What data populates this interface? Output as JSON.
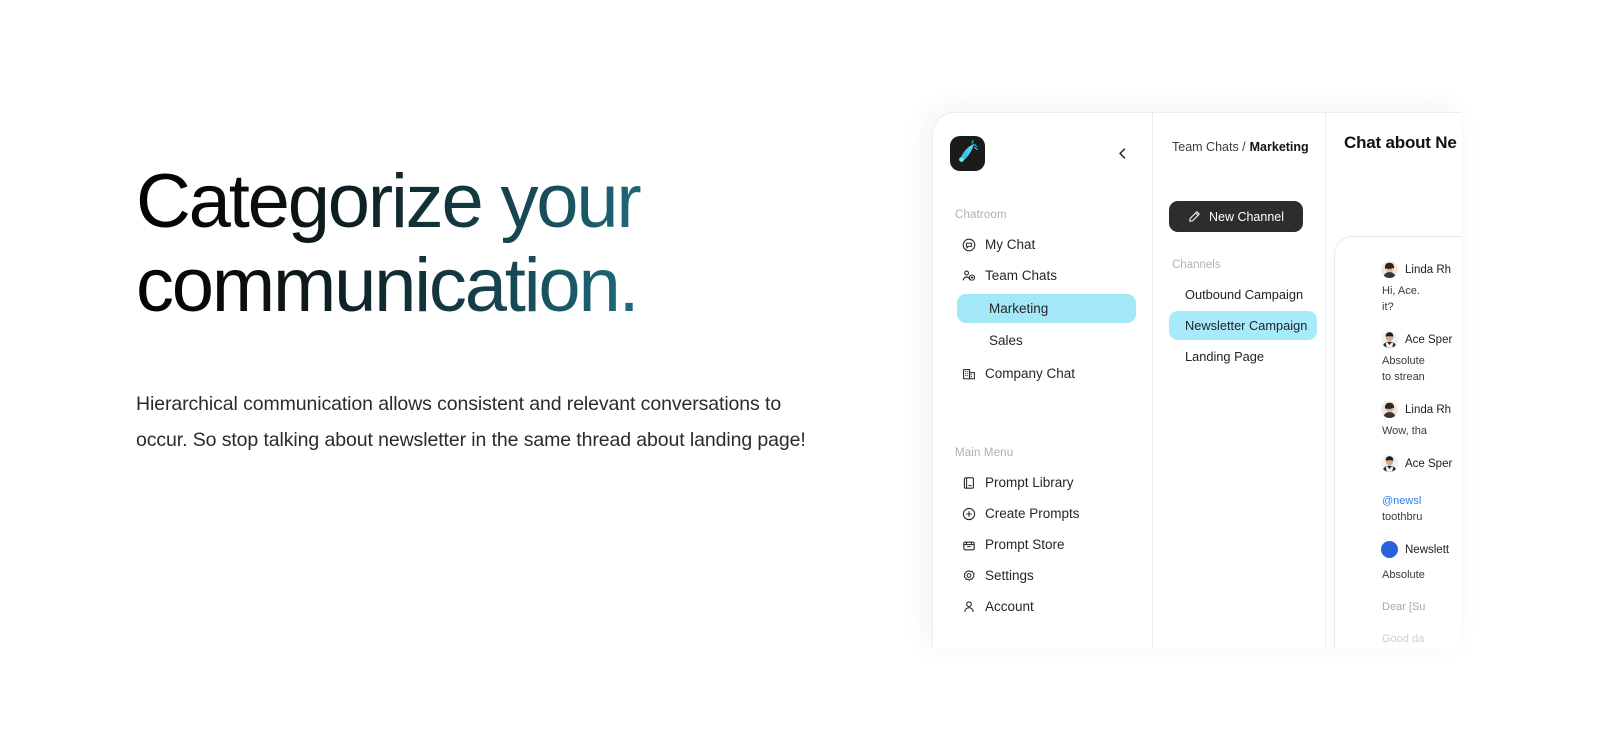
{
  "hero": {
    "headline": "Categorize your\ncommunication.",
    "body": "Hierarchical communication allows consistent and relevant conversations to\noccur. So stop talking about newsletter in the same thread about landing page!",
    "gradient_start": "#000000",
    "gradient_end": "#58c4d8"
  },
  "app": {
    "accent_highlight": "#a2e8f9",
    "dark_button": "#2d2d2d",
    "sidebar": {
      "logo_icon": "comet-feather-logo-icon",
      "collapse_icon": "chevron-left-icon",
      "groups": [
        {
          "label": "Chatroom",
          "items": [
            {
              "label": "My Chat",
              "icon": "chat-bubble-icon",
              "active": false
            },
            {
              "label": "Team Chats",
              "icon": "users-group-icon",
              "active": false
            }
          ],
          "sub_items": [
            {
              "label": "Marketing",
              "active": true
            },
            {
              "label": "Sales",
              "active": false
            }
          ],
          "trailing_items": [
            {
              "label": "Company Chat",
              "icon": "building-icon",
              "active": false
            }
          ]
        },
        {
          "label": "Main Menu",
          "items": [
            {
              "label": "Prompt Library",
              "icon": "book-icon",
              "active": false
            },
            {
              "label": "Create Prompts",
              "icon": "plus-circle-icon",
              "active": false
            },
            {
              "label": "Prompt Store",
              "icon": "store-icon",
              "active": false
            },
            {
              "label": "Settings",
              "icon": "gear-icon",
              "active": false
            },
            {
              "label": "Account",
              "icon": "person-icon",
              "active": false
            }
          ]
        }
      ]
    },
    "channels_panel": {
      "breadcrumb_parent": "Team Chats /",
      "breadcrumb_current": "Marketing",
      "new_channel_label": "New Channel",
      "new_channel_icon": "pencil-icon",
      "channels_label": "Channels",
      "channels": [
        {
          "label": "Outbound Campaign",
          "active": false
        },
        {
          "label": "Newsletter Campaign",
          "active": true
        },
        {
          "label": "Landing Page",
          "active": false
        }
      ]
    },
    "chat_panel": {
      "title": "Chat about Ne",
      "messages": [
        {
          "author": "Linda Rh",
          "avatar": "woman-avatar",
          "text": "Hi, Ace.\nit?",
          "fade": 0
        },
        {
          "author": "Ace Sper",
          "avatar": "man-avatar",
          "text": "Absolute\nto strean",
          "fade": 0
        },
        {
          "author": "Linda Rh",
          "avatar": "woman-avatar",
          "text": "Wow, thа",
          "fade": 0
        },
        {
          "author": "Ace Sper",
          "avatar": "man-avatar",
          "mention": "@newsl",
          "text": "toothbru",
          "fade": 0
        },
        {
          "author": "Newslett",
          "avatar": "bot-avatar",
          "text": "Absolute",
          "fade": 0
        },
        {
          "author": "",
          "avatar": "",
          "text": "Dear [Su",
          "fade": 2
        },
        {
          "author": "",
          "avatar": "",
          "text": "Good da\ncan mal",
          "fade": 3
        }
      ]
    }
  }
}
